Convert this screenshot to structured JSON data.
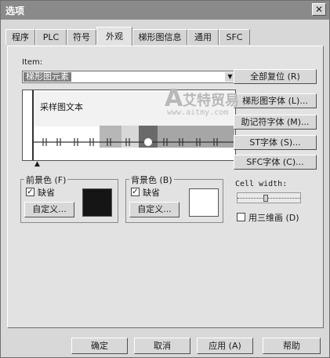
{
  "window": {
    "title": "选项",
    "close_glyph": "✕"
  },
  "tabs": [
    "程序",
    "PLC",
    "符号",
    "外观",
    "梯形图信息",
    "通用",
    "SFC"
  ],
  "selected_tab": "外观",
  "item": {
    "label": "Item:",
    "value": "梯形图元素"
  },
  "preview": {
    "sample_text": "采样图文本",
    "marker": "▲"
  },
  "side_buttons": {
    "reset_all": "全部复位 (R)",
    "ladder_font": "梯形图字体 (L)...",
    "mnemonic_font": "助记符字体 (M)...",
    "st_font": "ST字体 (S)...",
    "sfc_font": "SFC字体 (C)..."
  },
  "foreground": {
    "label": "前景色 (F)",
    "default_label": "缺省",
    "checked": true,
    "custom_label": "自定义...",
    "color": "#151515"
  },
  "background": {
    "label": "背景色 (B)",
    "default_label": "缺省",
    "checked": true,
    "custom_label": "自定义...",
    "color": "#ffffff"
  },
  "cell_width": {
    "label": "Cell width:"
  },
  "three_d": {
    "label": "用三维画 (D)",
    "checked": false
  },
  "bottom_buttons": {
    "ok": "确定",
    "cancel": "取消",
    "apply": "应用 (A)",
    "help": "帮助"
  },
  "watermark": {
    "brand": "艾特贸易",
    "url": "www.aitmy.com"
  },
  "colors": {
    "title_bar": "#8a8a8a",
    "selection": "#7c7c7c",
    "dialog": "#d8d8d8",
    "watermark": "#b8b8b8"
  }
}
